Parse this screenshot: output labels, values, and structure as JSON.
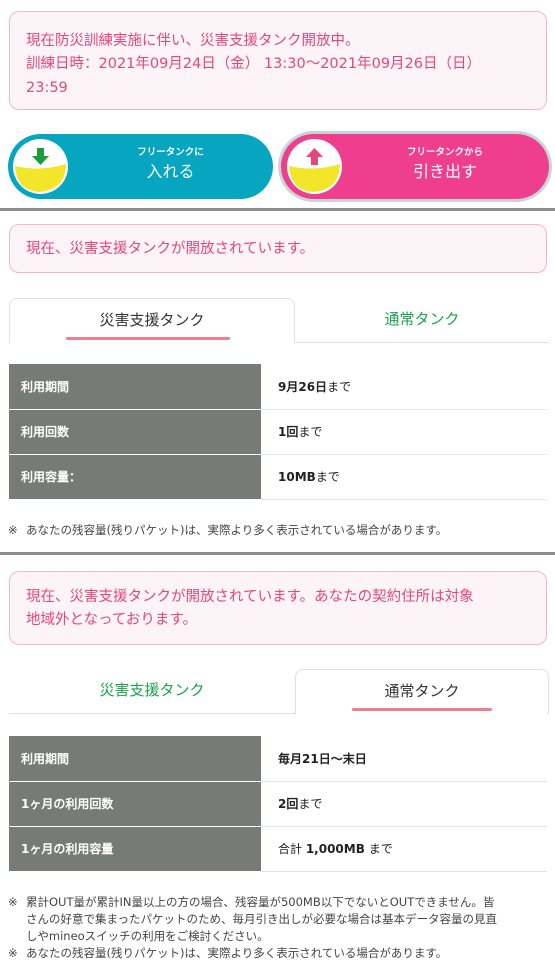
{
  "top_notice": {
    "line1": "現在防災訓練実施に伴い、災害支援タンク開放中。",
    "line2": "訓練日時：2021年09月24日（金） 13:30～2021年09月26日（日）",
    "line3": "23:59"
  },
  "buttons": {
    "deposit": {
      "small": "フリータンクに",
      "big": "入れる",
      "icon": "arrow-down-icon"
    },
    "withdraw": {
      "small": "フリータンクから",
      "big": "引き出す",
      "icon": "arrow-up-icon"
    }
  },
  "section1": {
    "notice": "現在、災害支援タンクが開放されています。",
    "tabs": [
      {
        "label": "災害支援タンク",
        "active": true
      },
      {
        "label": "通常タンク",
        "active": false
      }
    ],
    "rows": [
      {
        "label": "利用期間",
        "value_bold": "9月26日",
        "value_suffix": "まで"
      },
      {
        "label": "利用回数",
        "value_bold": "1回",
        "value_suffix": "まで"
      },
      {
        "label": "利用容量：",
        "value_bold": "10MB",
        "value_suffix": "まで"
      }
    ],
    "note": "あなたの残容量(残りパケット)は、実際より多く表示されている場合があります。"
  },
  "section2": {
    "notice_line1": "現在、災害支援タンクが開放されています。あなたの契約住所は対象",
    "notice_line2": "地域外となっております。",
    "tabs": [
      {
        "label": "災害支援タンク",
        "active": false
      },
      {
        "label": "通常タンク",
        "active": true
      }
    ],
    "rows": [
      {
        "label": "利用期間",
        "value_prefix": "",
        "value_bold": "毎月21日～末日",
        "value_suffix": ""
      },
      {
        "label": "1ヶ月の利用回数",
        "value_prefix": "",
        "value_bold": "2回",
        "value_suffix": "まで"
      },
      {
        "label": "1ヶ月の利用容量",
        "value_prefix": "合計 ",
        "value_bold": "1,000MB",
        "value_suffix": " まで"
      }
    ],
    "note1_line1": "累計OUT量が累計IN量以上の方の場合、残容量が500MB以下でないとOUTできません。皆",
    "note1_line2": "さんの好意で集まったパケットのため、毎月引き出しが必要な場合は基本データ容量の見直",
    "note1_line3": "しやmineoスイッチの利用をご検討ください。",
    "note2": "あなたの残容量(残りパケット)は、実際より多く表示されている場合があります。"
  },
  "note_mark": "※",
  "colors": {
    "accent_pink": "#e8457d",
    "deposit_blue": "#06a6c1",
    "withdraw_pink": "#ef3e8d",
    "tab_green": "#19a54d",
    "table_header": "#777b77",
    "icon_yellow": "#f2e52a"
  }
}
